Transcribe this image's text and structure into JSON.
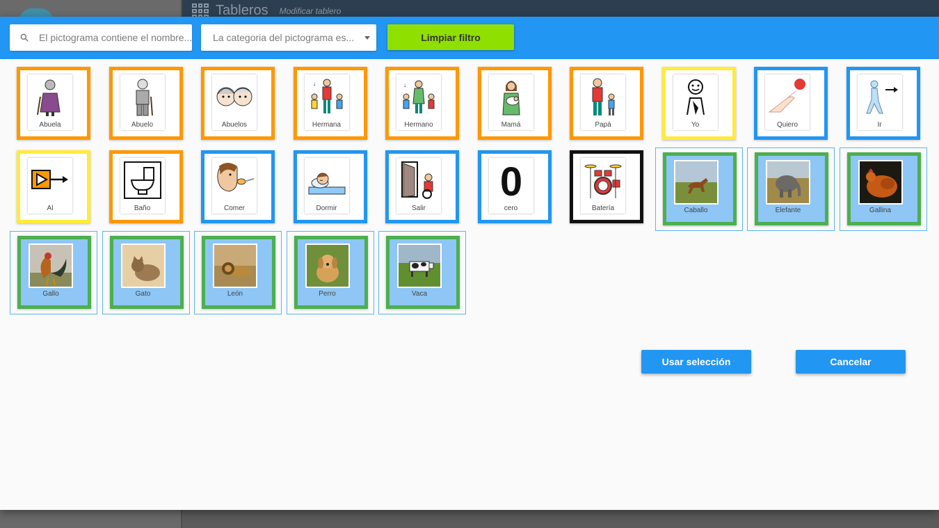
{
  "background": {
    "title": "Tableros",
    "subtitle": "Modificar tablero"
  },
  "toolbar": {
    "search_placeholder": "El pictograma contiene el nombre...",
    "category_placeholder": "La categoria del pictograma es...",
    "clear_filter_label": "Limpiar filtro"
  },
  "pictograms": [
    {
      "label": "Abuela",
      "border": "orange",
      "icon": "grandmother-icon",
      "selected": false
    },
    {
      "label": "Abuelo",
      "border": "orange",
      "icon": "grandfather-icon",
      "selected": false
    },
    {
      "label": "Abuelos",
      "border": "orange",
      "icon": "grandparents-icon",
      "selected": false
    },
    {
      "label": "Hermana",
      "border": "orange",
      "icon": "sister-icon",
      "selected": false
    },
    {
      "label": "Hermano",
      "border": "orange",
      "icon": "brother-icon",
      "selected": false
    },
    {
      "label": "Mamá",
      "border": "orange",
      "icon": "mother-icon",
      "selected": false
    },
    {
      "label": "Papá",
      "border": "orange",
      "icon": "father-icon",
      "selected": false
    },
    {
      "label": "Yo",
      "border": "yellow",
      "icon": "me-icon",
      "selected": false
    },
    {
      "label": "Quiero",
      "border": "blue",
      "icon": "want-icon",
      "selected": false
    },
    {
      "label": "Ir",
      "border": "blue",
      "icon": "go-icon",
      "selected": false
    },
    {
      "label": "Al",
      "border": "yellow",
      "icon": "to-the-icon",
      "selected": false
    },
    {
      "label": "Baño",
      "border": "orange",
      "icon": "bathroom-icon",
      "selected": false
    },
    {
      "label": "Comer",
      "border": "blue",
      "icon": "eat-icon",
      "selected": false
    },
    {
      "label": "Dormir",
      "border": "blue",
      "icon": "sleep-icon",
      "selected": false
    },
    {
      "label": "Salir",
      "border": "blue",
      "icon": "exit-icon",
      "selected": false
    },
    {
      "label": "cero",
      "border": "blue",
      "icon": "zero-icon",
      "selected": false
    },
    {
      "label": "Batería",
      "border": "black",
      "icon": "drums-icon",
      "selected": false
    },
    {
      "label": "Caballo",
      "border": "green",
      "icon": "horse-photo",
      "selected": true
    },
    {
      "label": "Elefante",
      "border": "green",
      "icon": "elephant-photo",
      "selected": true
    },
    {
      "label": "Gallina",
      "border": "green",
      "icon": "hen-photo",
      "selected": true
    },
    {
      "label": "Gallo",
      "border": "green",
      "icon": "rooster-photo",
      "selected": true
    },
    {
      "label": "Gato",
      "border": "green",
      "icon": "cat-photo",
      "selected": true
    },
    {
      "label": "León",
      "border": "green",
      "icon": "lion-photo",
      "selected": true
    },
    {
      "label": "Perro",
      "border": "green",
      "icon": "dog-photo",
      "selected": true
    },
    {
      "label": "Vaca",
      "border": "green",
      "icon": "cow-photo",
      "selected": true
    }
  ],
  "actions": {
    "use_selection_label": "Usar selección",
    "cancel_label": "Cancelar"
  },
  "colors": {
    "primary": "#2196f3",
    "clear_filter": "#8fe000",
    "orange": "#ff9800",
    "yellow": "#ffeb3b",
    "blue": "#2196f3",
    "black": "#111111",
    "green": "#4caf50",
    "selected_bg": "#8ec6f5"
  }
}
